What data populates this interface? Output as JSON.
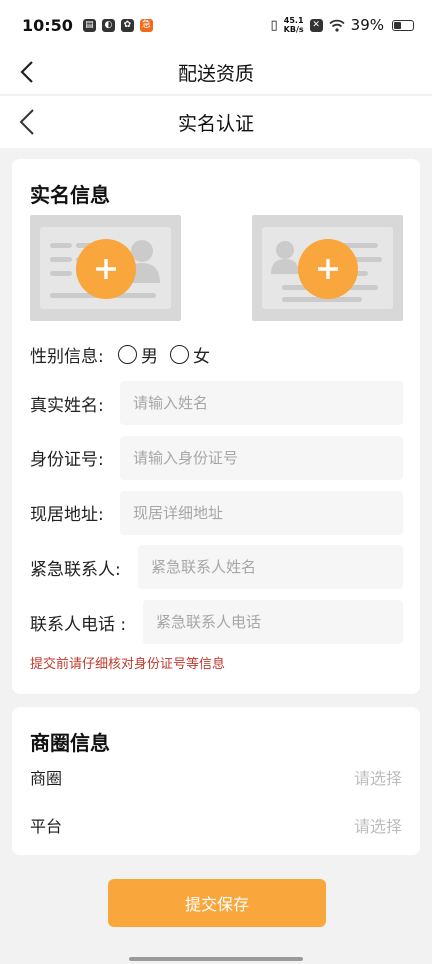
{
  "status_bar": {
    "time": "10:50",
    "net_speed_top": "45.1",
    "net_speed_unit": "KB/s",
    "battery": "39%",
    "battery_level": 0.39,
    "notify_badge": "急"
  },
  "header_primary": {
    "title": "配送资质"
  },
  "header_secondary": {
    "title": "实名认证"
  },
  "real_name": {
    "section_title": "实名信息",
    "gender": {
      "label": "性别信息:",
      "options": [
        "男",
        "女"
      ]
    },
    "name": {
      "label": "真实姓名:",
      "placeholder": "请输入姓名"
    },
    "id_number": {
      "label": "身份证号:",
      "placeholder": "请输入身份证号"
    },
    "address": {
      "label": "现居地址:",
      "placeholder": "现居详细地址"
    },
    "emergency_contact": {
      "label": "紧急联系人:",
      "placeholder": "紧急联系人姓名"
    },
    "contact_phone": {
      "label": "联系人电话 :",
      "placeholder": "紧急联系人电话"
    },
    "warning": "提交前请仔细核对身份证号等信息"
  },
  "business": {
    "section_title": "商圈信息",
    "rows": [
      {
        "label": "商圈",
        "value": "请选择"
      },
      {
        "label": "平台",
        "value": "请选择"
      }
    ]
  },
  "submit": {
    "label": "提交保存"
  },
  "colors": {
    "accent": "#f9a63c",
    "warning": "#c0392b",
    "background": "#f2f2f2"
  }
}
